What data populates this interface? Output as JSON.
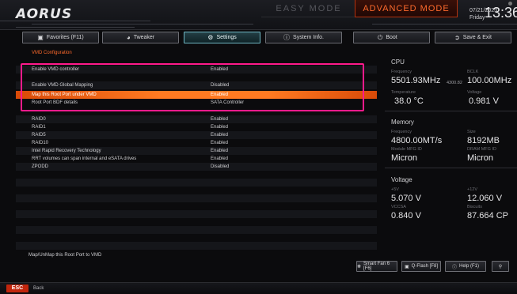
{
  "header": {
    "brand": "AORUS",
    "easy_mode": "EASY MODE",
    "advanced_mode": "ADVANCED MODE",
    "date": "07/21/2023",
    "day": "Friday",
    "time": "13:36"
  },
  "tabs": [
    {
      "label": "Favorites (F11)",
      "icon": "star-box-icon"
    },
    {
      "label": "Tweaker",
      "icon": "gauge-icon"
    },
    {
      "label": "Settings",
      "icon": "gear-icon",
      "active": true
    },
    {
      "label": "System Info.",
      "icon": "info-icon"
    },
    {
      "label": "Boot",
      "icon": "power-icon"
    },
    {
      "label": "Save & Exit",
      "icon": "exit-icon"
    }
  ],
  "main": {
    "section_title": "VMD Configuration",
    "rows": [
      {
        "label": "Enable VMD controller",
        "value": "Enabled"
      },
      {
        "label": "Enable VMD Global Mapping",
        "value": "Disabled"
      },
      {
        "label": "Map this Root Port under VMD",
        "value": "Enabled"
      },
      {
        "label": "Root Port BDF details",
        "value": "SATA Controller"
      },
      {
        "label": "RAID0",
        "value": "Enabled"
      },
      {
        "label": "RAID1",
        "value": "Enabled"
      },
      {
        "label": "RAID5",
        "value": "Enabled"
      },
      {
        "label": "RAID10",
        "value": "Enabled"
      },
      {
        "label": "Intel Rapid Recovery Technology",
        "value": "Enabled"
      },
      {
        "label": "RRT volumes can span internal and eSATA drives",
        "value": "Enabled"
      },
      {
        "label": "ZPODD",
        "value": "Disabled"
      }
    ],
    "description": "Map/UnMap this Root Port to VMD"
  },
  "side": {
    "cpu": {
      "title": "CPU",
      "frequency_label": "Frequency",
      "frequency": "5501.93MHz",
      "frequency_sub": "4300.82",
      "bclk_label": "BCLK",
      "bclk": "100.00MHz",
      "temp_label": "Temperature",
      "temp": "38.0 °C",
      "voltage_label": "Voltage",
      "voltage": "0.981 V"
    },
    "memory": {
      "title": "Memory",
      "frequency_label": "Frequency",
      "frequency": "4800.00MT/s",
      "size_label": "Size",
      "size": "8192MB",
      "module_label": "Module MFG ID",
      "module": "Micron",
      "dram_label": "DRAM MFG ID",
      "dram": "Micron"
    },
    "voltage": {
      "title": "Voltage",
      "v5_label": "+5V",
      "v5": "5.070 V",
      "v12_label": "+12V",
      "v12": "12.060 V",
      "vccsa_label": "VCCSA",
      "vccsa": "0.840 V",
      "biscuits_label": "Biscuits",
      "biscuits": "87.664 CP"
    }
  },
  "bottom": {
    "smart_fan": "Smart Fan 6 [F6]",
    "qflash": "Q-Flash [F8]",
    "help": "Help (F1)"
  },
  "footer": {
    "esc": "ESC",
    "back": "Back"
  },
  "colors": {
    "accent_orange": "#ff6a2c",
    "highlight_pink": "#ff1a8c",
    "esc_red": "#c2260d"
  }
}
